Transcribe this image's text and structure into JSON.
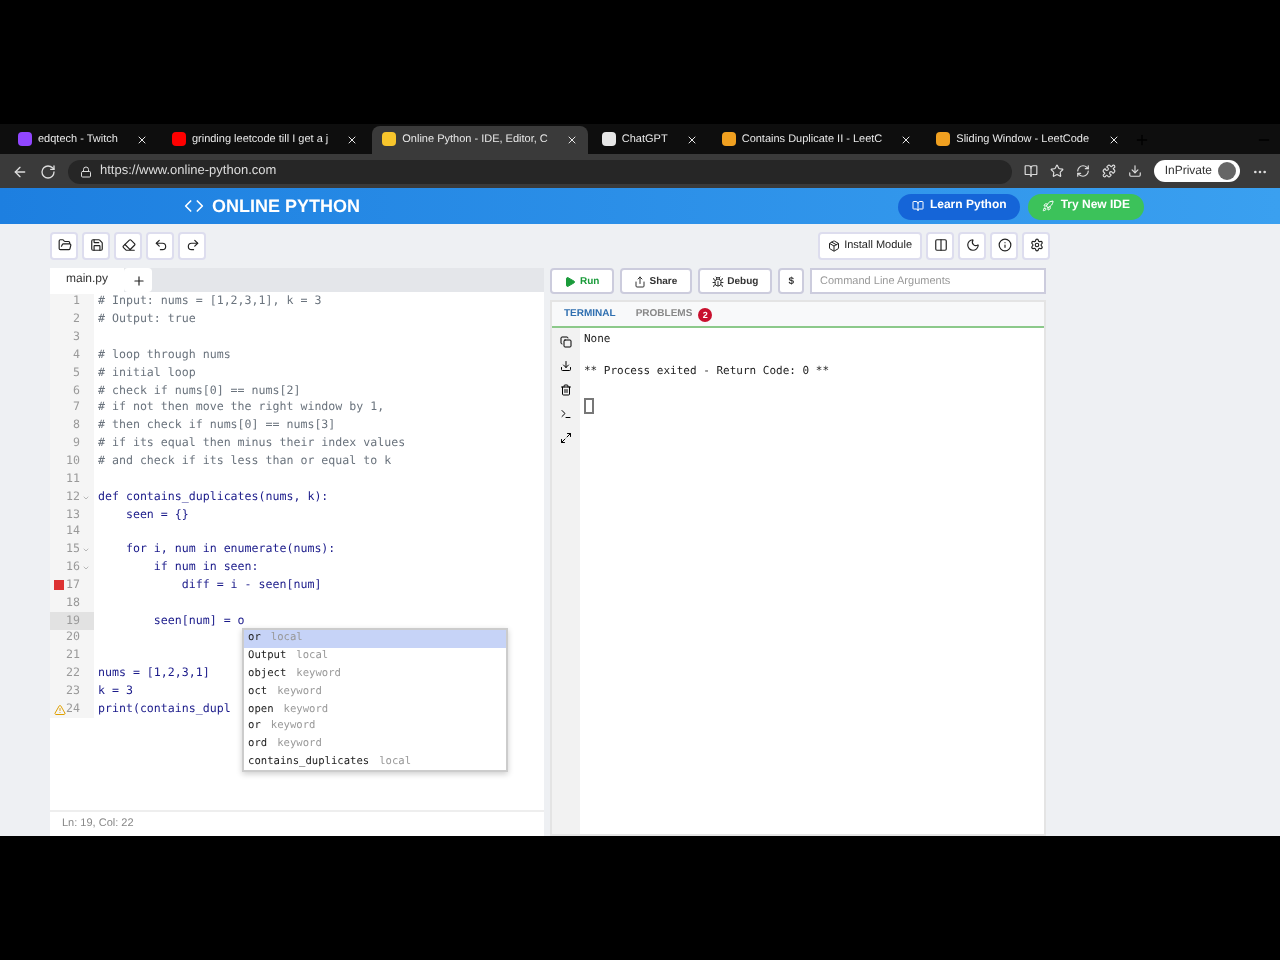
{
  "browser": {
    "tabs": [
      {
        "label": "edqtech - Twitch",
        "selected": false
      },
      {
        "label": "grinding leetcode till I get a j",
        "selected": false
      },
      {
        "label": "Online Python - IDE, Editor, C",
        "selected": true
      },
      {
        "label": "ChatGPT",
        "selected": false
      },
      {
        "label": "Contains Duplicate II - LeetC",
        "selected": false
      },
      {
        "label": "Sliding Window - LeetCode",
        "selected": false
      }
    ],
    "url": "https://www.online-python.com",
    "profile": "InPrivate"
  },
  "site": {
    "logo": "ONLINE PYTHON",
    "buttons": [
      {
        "label": "Learn Python",
        "kind": "blue"
      },
      {
        "label": "Try New IDE",
        "kind": "green"
      }
    ]
  },
  "toolbar": {
    "install": "Install Module"
  },
  "editor": {
    "file_tab": "main.py",
    "lines": [
      {
        "no": "1",
        "text": "# Input: nums = [1,2,3,1], k = 3",
        "kind": "comment"
      },
      {
        "no": "2",
        "text": "# Output: true",
        "kind": "comment"
      },
      {
        "no": "3"
      },
      {
        "no": "4",
        "text": "# loop through nums",
        "kind": "comment"
      },
      {
        "no": "5",
        "text": "# initial loop",
        "kind": "comment"
      },
      {
        "no": "6",
        "text": "# check if nums[0] == nums[2]",
        "kind": "comment"
      },
      {
        "no": "7",
        "text": "# if not then move the right window by 1,",
        "kind": "comment"
      },
      {
        "no": "8",
        "text": "# then check if nums[0] == nums[3]",
        "kind": "comment"
      },
      {
        "no": "9",
        "text": "# if its equal then minus their index values",
        "kind": "comment"
      },
      {
        "no": "10",
        "text": "# and check if its less than or equal to k",
        "kind": "comment"
      },
      {
        "no": "11"
      },
      {
        "no": "12",
        "text": "def contains_duplicates(nums, k):",
        "kind": "code",
        "fold": true
      },
      {
        "no": "13",
        "text": "    seen = {}",
        "kind": "code"
      },
      {
        "no": "14"
      },
      {
        "no": "15",
        "text": "    for i, num in enumerate(nums):",
        "kind": "code",
        "fold": true
      },
      {
        "no": "16",
        "text": "        if num in seen:",
        "kind": "code",
        "fold": true
      },
      {
        "no": "17",
        "text": "            diff = i - seen[num]",
        "kind": "code",
        "error": true
      },
      {
        "no": "18"
      },
      {
        "no": "19",
        "text": "        seen[num] = o",
        "kind": "code",
        "active": true
      },
      {
        "no": "20"
      },
      {
        "no": "21"
      },
      {
        "no": "22",
        "text": "nums = [1,2,3,1]",
        "kind": "code"
      },
      {
        "no": "23",
        "text": "k = 3",
        "kind": "code"
      },
      {
        "no": "24",
        "text": "print(contains_dupl",
        "kind": "code",
        "warning": true
      }
    ],
    "suggestions": [
      {
        "label": "or",
        "type": "local",
        "selected": true
      },
      {
        "label": "Output",
        "type": "local",
        "selected": false
      },
      {
        "label": "object",
        "type": "keyword",
        "selected": false
      },
      {
        "label": "oct",
        "type": "keyword",
        "selected": false
      },
      {
        "label": "open",
        "type": "keyword",
        "selected": false
      },
      {
        "label": "or",
        "type": "keyword",
        "selected": false
      },
      {
        "label": "ord",
        "type": "keyword",
        "selected": false
      },
      {
        "label": "contains_duplicates",
        "type": "local",
        "selected": false
      }
    ],
    "status": "Ln: 19,  Col: 22"
  },
  "run_bar": {
    "buttons": [
      {
        "label": "Run",
        "kind": "run"
      },
      {
        "label": "Share",
        "kind": "share"
      },
      {
        "label": "Debug",
        "kind": "debug"
      },
      {
        "label": "$",
        "kind": "dollar"
      }
    ],
    "args_placeholder": "Command Line Arguments"
  },
  "terminal": {
    "tabs": [
      {
        "label": "TERMINAL",
        "selected": true
      },
      {
        "label": "PROBLEMS",
        "selected": false,
        "badge": "2"
      }
    ],
    "output": [
      "None",
      "** Process exited - Return Code: 0 **"
    ]
  }
}
